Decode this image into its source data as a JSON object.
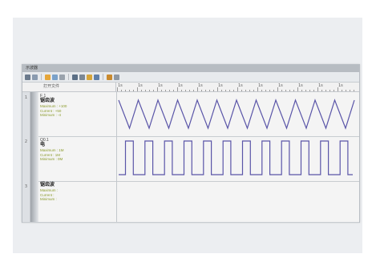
{
  "window": {
    "title": "示波器"
  },
  "toolbar": {
    "buttons": [
      {
        "icon": "play-icon",
        "color": "#6b7a8c"
      },
      {
        "icon": "open-icon",
        "color": "#8a9bb0"
      },
      {
        "icon": "save-icon",
        "color": "#e5a63a"
      },
      {
        "icon": "zoom-icon",
        "color": "#7aa1c9"
      },
      {
        "icon": "pencil-icon",
        "color": "#9aa3ad"
      },
      {
        "icon": "cursor-icon",
        "color": "#5b6f86"
      },
      {
        "icon": "grid-icon",
        "color": "#7b8895"
      },
      {
        "icon": "color-icon",
        "color": "#d6a53a"
      },
      {
        "icon": "trigger-icon",
        "color": "#5f7fa8"
      },
      {
        "icon": "settings-icon",
        "color": "#c98a2e"
      },
      {
        "icon": "stop-icon",
        "color": "#8e98a3"
      }
    ]
  },
  "header": {
    "column_label": "打开文件"
  },
  "ruler": {
    "labels": [
      "1s",
      "1s",
      "1s",
      "1s",
      "1s",
      "1s",
      "1s",
      "1s",
      "1s",
      "1s",
      "1s",
      "1s"
    ]
  },
  "tracks": [
    {
      "num": "1",
      "id": "F 1",
      "name": "锯齿波",
      "meta": [
        "Maximum : +100",
        "Current : +50",
        "Minimum : -4"
      ],
      "wave": "sawtooth",
      "color": "#5a55a8"
    },
    {
      "num": "2",
      "id": "Q0.1",
      "name": "电",
      "meta": [
        "Maximum : 1M",
        "Current : 1M",
        "Minimum : 0M"
      ],
      "wave": "square",
      "color": "#5a55a8"
    },
    {
      "num": "3",
      "id": "",
      "name": "锯齿波",
      "meta": [
        "Maximum :",
        "Current :",
        "Minimum :"
      ],
      "wave": "none",
      "color": "#5a55a8"
    }
  ]
}
